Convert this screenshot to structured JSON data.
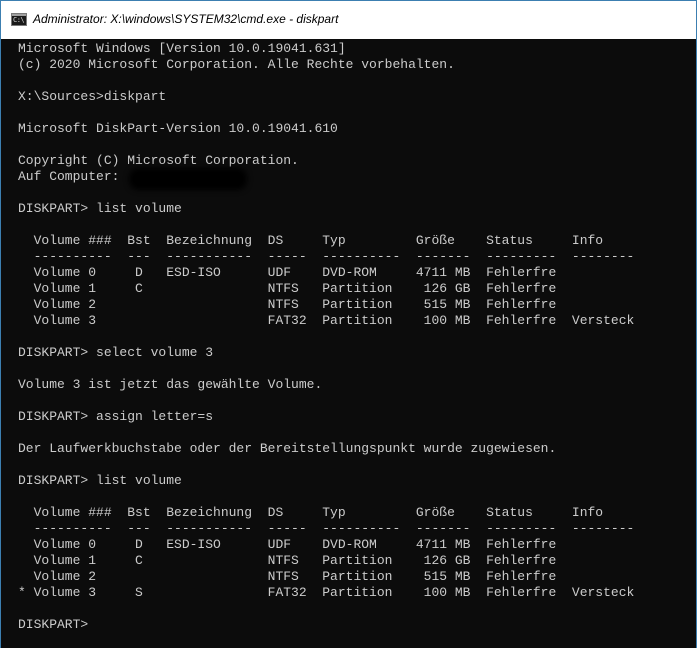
{
  "window": {
    "title": "Administrator: X:\\windows\\SYSTEM32\\cmd.exe - diskpart",
    "icon": "cmd-icon",
    "icon_text": "C:\\",
    "accent_color": "#3c7fb1",
    "console_background": "#0c0c0c",
    "console_foreground": "#cccccc"
  },
  "console": {
    "lines": [
      "Microsoft Windows [Version 10.0.19041.631]",
      "(c) 2020 Microsoft Corporation. Alle Rechte vorbehalten.",
      "",
      "X:\\Sources>diskpart",
      "",
      "Microsoft DiskPart-Version 10.0.19041.610",
      "",
      "Copyright (C) Microsoft Corporation.",
      "Auf Computer: ",
      "",
      "DISKPART> list volume",
      "",
      "  Volume ###  Bst  Bezeichnung  DS     Typ         Größe    Status     Info",
      "  ----------  ---  -----------  -----  ----------  -------  ---------  --------",
      "  Volume 0     D   ESD-ISO      UDF    DVD-ROM     4711 MB  Fehlerfre",
      "  Volume 1     C                NTFS   Partition    126 GB  Fehlerfre",
      "  Volume 2                      NTFS   Partition    515 MB  Fehlerfre",
      "  Volume 3                      FAT32  Partition    100 MB  Fehlerfre  Versteck",
      "",
      "DISKPART> select volume 3",
      "",
      "Volume 3 ist jetzt das gewählte Volume.",
      "",
      "DISKPART> assign letter=s",
      "",
      "Der Laufwerkbuchstabe oder der Bereitstellungspunkt wurde zugewiesen.",
      "",
      "DISKPART> list volume",
      "",
      "  Volume ###  Bst  Bezeichnung  DS     Typ         Größe    Status     Info",
      "  ----------  ---  -----------  -----  ----------  -------  ---------  --------",
      "  Volume 0     D   ESD-ISO      UDF    DVD-ROM     4711 MB  Fehlerfre",
      "  Volume 1     C                NTFS   Partition    126 GB  Fehlerfre",
      "  Volume 2                      NTFS   Partition    515 MB  Fehlerfre",
      "* Volume 3     S                FAT32  Partition    100 MB  Fehlerfre  Versteck",
      "",
      "DISKPART> "
    ]
  }
}
